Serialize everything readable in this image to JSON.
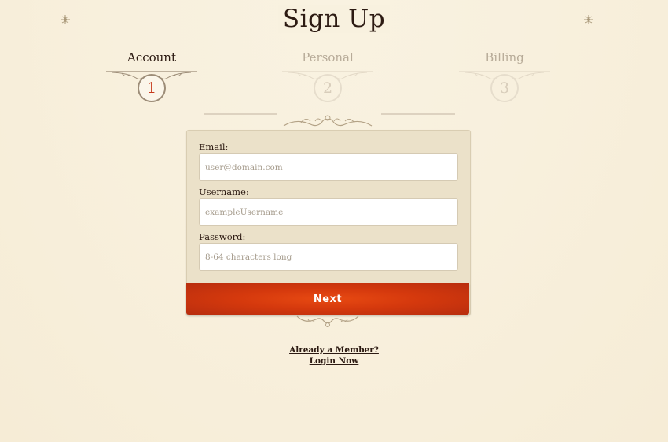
{
  "page": {
    "title": "Sign Up"
  },
  "steps": [
    {
      "label": "Account",
      "number": "1",
      "state": "active"
    },
    {
      "label": "Personal",
      "number": "2",
      "state": "inactive"
    },
    {
      "label": "Billing",
      "number": "3",
      "state": "inactive"
    }
  ],
  "form": {
    "email": {
      "label": "Email:",
      "value": "",
      "placeholder": "user@domain.com"
    },
    "username": {
      "label": "Username:",
      "value": "",
      "placeholder": "exampleUsername"
    },
    "password": {
      "label": "Password:",
      "value": "",
      "placeholder": "8-64 characters long"
    },
    "next_label": "Next"
  },
  "footer": {
    "member_question": "Already a Member?",
    "login_link": "Login Now"
  },
  "colors": {
    "accent": "#d5390d",
    "active_step_number": "#c6391b",
    "panel": "#ebe1c9",
    "background": "#f8f0dd"
  },
  "icons": {
    "header_left": "fleuron-icon",
    "header_right": "fleuron-icon",
    "divider": "scroll-ornament-icon"
  }
}
